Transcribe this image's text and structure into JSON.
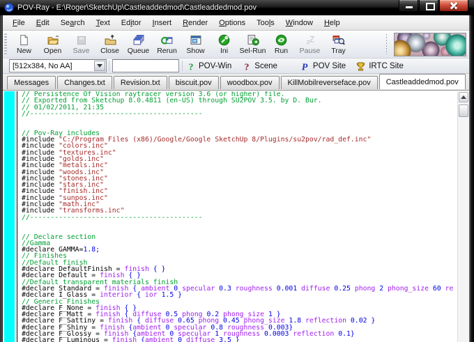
{
  "window": {
    "title": "POV-Ray - E:\\Roger\\SketchUp\\Castleaddedmod\\Castleaddedmod.pov",
    "controls": [
      "minimize",
      "maximize",
      "close"
    ]
  },
  "menubar": {
    "items": [
      {
        "label": "File",
        "mnemonic": 0
      },
      {
        "label": "Edit",
        "mnemonic": 0
      },
      {
        "label": "Search",
        "mnemonic": 2
      },
      {
        "label": "Text",
        "mnemonic": 0
      },
      {
        "label": "Editor",
        "mnemonic": 2
      },
      {
        "label": "Insert",
        "mnemonic": 0
      },
      {
        "label": "Render",
        "mnemonic": 0
      },
      {
        "label": "Options",
        "mnemonic": 0
      },
      {
        "label": "Tools",
        "mnemonic": 3
      },
      {
        "label": "Window",
        "mnemonic": 0
      },
      {
        "label": "Help",
        "mnemonic": 0
      }
    ]
  },
  "toolbar": {
    "buttons": [
      {
        "label": "New",
        "icon": "new-file-icon",
        "disabled": false
      },
      {
        "label": "Open",
        "icon": "open-folder-icon",
        "disabled": false
      },
      {
        "label": "Save",
        "icon": "save-icon",
        "disabled": true
      },
      {
        "label": "Close",
        "icon": "close-file-icon",
        "disabled": false
      },
      {
        "label": "Queue",
        "icon": "queue-icon",
        "disabled": false
      },
      {
        "label": "Rerun",
        "icon": "rerun-icon",
        "disabled": false
      },
      {
        "label": "Show",
        "icon": "show-window-icon",
        "disabled": false
      },
      {
        "label": "Ini",
        "icon": "ini-icon",
        "disabled": false
      },
      {
        "label": "Sel-Run",
        "icon": "sel-run-icon",
        "disabled": false
      },
      {
        "label": "Run",
        "icon": "run-icon",
        "disabled": false
      },
      {
        "label": "Pause",
        "icon": "pause-icon",
        "disabled": true
      },
      {
        "label": "Tray",
        "icon": "tray-icon",
        "disabled": false
      }
    ],
    "preview_image": "marble-spheres-render"
  },
  "toolbar2": {
    "resolution": "[512x384, No AA]",
    "command_value": "",
    "links": [
      {
        "label": "POV-Win",
        "icon": "help-povwin-icon"
      },
      {
        "label": "Scene",
        "icon": "help-scene-icon"
      },
      {
        "label": "POV Site",
        "icon": "pov-site-icon"
      },
      {
        "label": "IRTC Site",
        "icon": "irtc-site-icon"
      }
    ]
  },
  "tabbar": {
    "tabs": [
      {
        "label": "Messages",
        "active": false
      },
      {
        "label": "Changes.txt",
        "active": false
      },
      {
        "label": "Revision.txt",
        "active": false
      },
      {
        "label": "biscuit.pov",
        "active": false
      },
      {
        "label": "woodbox.pov",
        "active": false
      },
      {
        "label": "KillMobilreverseface.pov",
        "active": false
      },
      {
        "label": "Castleaddedmod.pov",
        "active": true
      }
    ]
  },
  "colors": {
    "margin_cyan": "#00ffff",
    "comment_green": "#00a033",
    "string_red": "#a52a2a",
    "keyword_purple": "#a020f0",
    "number_blue": "#0000e6",
    "close_button_red": "#c9443d"
  },
  "editor": {
    "lines": [
      [
        [
          "c",
          "// Persistence Of Vision raytracer version 3.6 (or higher) file."
        ]
      ],
      [
        [
          "c",
          "// Exported from Sketchup 8.0.4811 (en-US) through SU2POV 3.5. by D. Bur."
        ]
      ],
      [
        [
          "c",
          "// 01/02/2011, 21:35"
        ]
      ],
      [
        [
          "c",
          "//------------------------------------------"
        ]
      ],
      [],
      [],
      [
        [
          "c",
          "// Pov-Ray includes"
        ]
      ],
      [
        [
          "p",
          "#include "
        ],
        [
          "s",
          "\"C:/Program Files (x86)/Google/Google SketchUp 8/Plugins/su2pov/rad_def.inc\""
        ]
      ],
      [
        [
          "p",
          "#include "
        ],
        [
          "s",
          "\"colors.inc\""
        ]
      ],
      [
        [
          "p",
          "#include "
        ],
        [
          "s",
          "\"textures.inc\""
        ]
      ],
      [
        [
          "p",
          "#include "
        ],
        [
          "s",
          "\"golds.inc\""
        ]
      ],
      [
        [
          "p",
          "#include "
        ],
        [
          "s",
          "\"metals.inc\""
        ]
      ],
      [
        [
          "p",
          "#include "
        ],
        [
          "s",
          "\"woods.inc\""
        ]
      ],
      [
        [
          "p",
          "#include "
        ],
        [
          "s",
          "\"stones.inc\""
        ]
      ],
      [
        [
          "p",
          "#include "
        ],
        [
          "s",
          "\"stars.inc\""
        ]
      ],
      [
        [
          "p",
          "#include "
        ],
        [
          "s",
          "\"finish.inc\""
        ]
      ],
      [
        [
          "p",
          "#include "
        ],
        [
          "s",
          "\"sunpos.inc\""
        ]
      ],
      [
        [
          "p",
          "#include "
        ],
        [
          "s",
          "\"math.inc\""
        ]
      ],
      [
        [
          "p",
          "#include "
        ],
        [
          "s",
          "\"transforms.inc\""
        ]
      ],
      [
        [
          "c",
          "//------------------------------------------"
        ]
      ],
      [],
      [],
      [
        [
          "c",
          "// Declare section"
        ]
      ],
      [
        [
          "c",
          "//Gamma"
        ]
      ],
      [
        [
          "p",
          "#declare GAMMA="
        ],
        [
          "n",
          "1.8;"
        ]
      ],
      [
        [
          "c",
          "// Finishes"
        ]
      ],
      [
        [
          "c",
          "//Default finish"
        ]
      ],
      [
        [
          "p",
          "#declare DefaultFinish = "
        ],
        [
          "k",
          "finish"
        ],
        [
          "n",
          " { }"
        ]
      ],
      [
        [
          "p",
          "#declare Default = "
        ],
        [
          "k",
          "finish"
        ],
        [
          "n",
          " { }"
        ]
      ],
      [
        [
          "c",
          "//Default transparent materials finish"
        ]
      ],
      [
        [
          "p",
          "#declare Standard = "
        ],
        [
          "k",
          "finish"
        ],
        [
          "n",
          " { "
        ],
        [
          "k",
          "ambient"
        ],
        [
          "n",
          " 0 "
        ],
        [
          "k",
          "specular"
        ],
        [
          "n",
          " 0.3 "
        ],
        [
          "k",
          "roughness"
        ],
        [
          "n",
          " 0.001 "
        ],
        [
          "k",
          "diffuse"
        ],
        [
          "n",
          " 0.25 "
        ],
        [
          "k",
          "phong"
        ],
        [
          "n",
          " 2 "
        ],
        [
          "k",
          "phong_size"
        ],
        [
          "n",
          " 60 "
        ],
        [
          "k",
          "re"
        ]
      ],
      [
        [
          "p",
          "#declare I_Glass = "
        ],
        [
          "k",
          "interior"
        ],
        [
          "n",
          " { "
        ],
        [
          "k",
          "ior"
        ],
        [
          "n",
          " 1.5 }"
        ]
      ],
      [
        [
          "c",
          "// Generic Finishes"
        ]
      ],
      [
        [
          "p",
          "#declare F_None = "
        ],
        [
          "k",
          "finish"
        ],
        [
          "n",
          " { }"
        ]
      ],
      [
        [
          "p",
          "#declare F_Matt = "
        ],
        [
          "k",
          "finish"
        ],
        [
          "n",
          " { "
        ],
        [
          "k",
          "diffuse"
        ],
        [
          "n",
          " 0.5 "
        ],
        [
          "k",
          "phong"
        ],
        [
          "n",
          " 0.2 "
        ],
        [
          "k",
          "phong_size"
        ],
        [
          "n",
          " 1 }"
        ]
      ],
      [
        [
          "p",
          "#declare F_Sattiny = "
        ],
        [
          "k",
          "finish"
        ],
        [
          "n",
          " { "
        ],
        [
          "k",
          "diffuse"
        ],
        [
          "n",
          " 0.65 "
        ],
        [
          "k",
          "phong"
        ],
        [
          "n",
          " 0.45 "
        ],
        [
          "k",
          "phong_size"
        ],
        [
          "n",
          " 1.8 "
        ],
        [
          "k",
          "reflection"
        ],
        [
          "n",
          " 0.02 }"
        ]
      ],
      [
        [
          "p",
          "#declare F_Shiny = "
        ],
        [
          "k",
          "finish"
        ],
        [
          "n",
          " {"
        ],
        [
          "k",
          "ambient"
        ],
        [
          "n",
          " 0 "
        ],
        [
          "k",
          "specular"
        ],
        [
          "n",
          " 0.8 "
        ],
        [
          "k",
          "roughness"
        ],
        [
          "n",
          " 0.003}"
        ]
      ],
      [
        [
          "p",
          "#declare F_Glossy = "
        ],
        [
          "k",
          "finish"
        ],
        [
          "n",
          " {"
        ],
        [
          "k",
          "ambient"
        ],
        [
          "n",
          " 0 "
        ],
        [
          "k",
          "specular"
        ],
        [
          "n",
          " 1 "
        ],
        [
          "k",
          "roughness"
        ],
        [
          "n",
          " 0.0003 "
        ],
        [
          "k",
          "reflection"
        ],
        [
          "n",
          " 0.1}"
        ]
      ],
      [
        [
          "p",
          "#declare F_Luminous = "
        ],
        [
          "k",
          "finish"
        ],
        [
          "n",
          " {"
        ],
        [
          "k",
          "ambient"
        ],
        [
          "n",
          " 0 "
        ],
        [
          "k",
          "diffuse"
        ],
        [
          "n",
          " 3.5 }"
        ]
      ]
    ]
  }
}
